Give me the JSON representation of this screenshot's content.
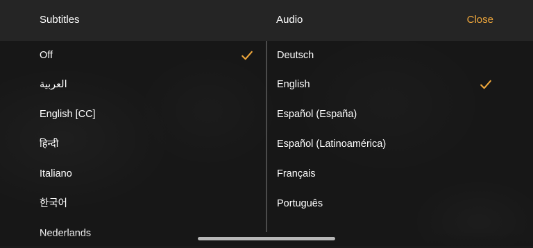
{
  "colors": {
    "accent": "#f0a83c",
    "background": "#1a1a1a",
    "header_background": "#252525",
    "text": "#ffffff",
    "divider": "#4b4b4b"
  },
  "header": {
    "subtitles_label": "Subtitles",
    "audio_label": "Audio",
    "close_label": "Close"
  },
  "subtitles": {
    "selected_index": 0,
    "items": [
      {
        "label": "Off",
        "selected": true
      },
      {
        "label": "العربية",
        "selected": false
      },
      {
        "label": "English [CC]",
        "selected": false
      },
      {
        "label": "हिन्दी",
        "selected": false
      },
      {
        "label": "Italiano",
        "selected": false
      },
      {
        "label": "한국어",
        "selected": false
      },
      {
        "label": "Nederlands",
        "selected": false
      }
    ]
  },
  "audio": {
    "selected_index": 1,
    "items": [
      {
        "label": "Deutsch",
        "selected": false
      },
      {
        "label": "English",
        "selected": true
      },
      {
        "label": "Español (España)",
        "selected": false
      },
      {
        "label": "Español (Latinoamérica)",
        "selected": false
      },
      {
        "label": "Français",
        "selected": false
      },
      {
        "label": "Português",
        "selected": false
      }
    ]
  },
  "icons": {
    "subtitles_checkmark": "check-icon",
    "audio_checkmark": "check-icon"
  }
}
